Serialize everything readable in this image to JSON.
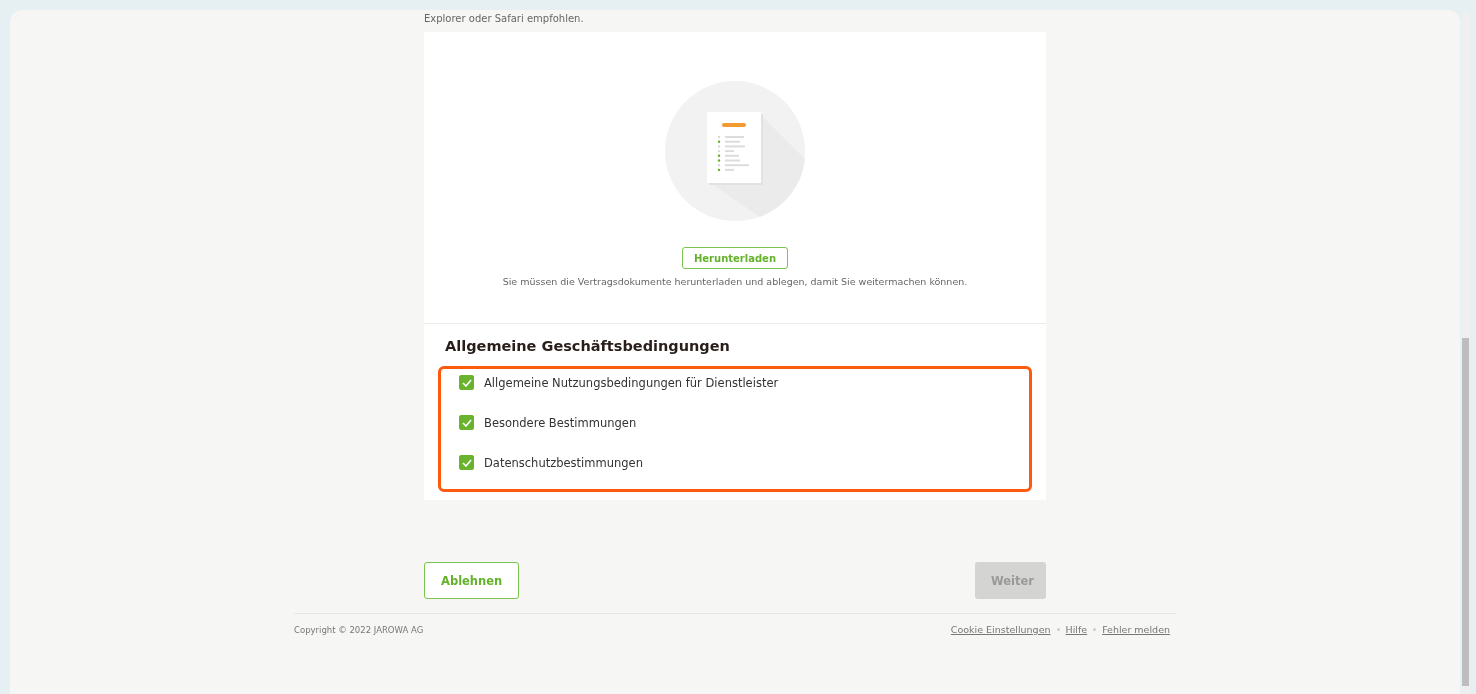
{
  "intro_text": "Explorer oder Safari empfohlen.",
  "download": {
    "button": "Herunterladen",
    "hint": "Sie müssen die Vertragsdokumente herunterladen und ablegen, damit Sie weitermachen können."
  },
  "terms": {
    "title": "Allgemeine Geschäftsbedingungen",
    "highlighted": true,
    "items": [
      {
        "label": "Allgemeine Nutzungsbedingungen für Dienstleister",
        "checked": true
      },
      {
        "label": "Besondere Bestimmungen",
        "checked": true
      },
      {
        "label": "Datenschutzbestimmungen",
        "checked": true
      }
    ]
  },
  "actions": {
    "decline": {
      "label": "Ablehnen",
      "disabled": false
    },
    "next": {
      "label": "Weiter",
      "disabled": true
    }
  },
  "footer": {
    "copyright": "Copyright © 2022 JAROWA AG",
    "links": [
      "Cookie Einstellungen",
      "Hilfe",
      "Fehler melden"
    ]
  }
}
